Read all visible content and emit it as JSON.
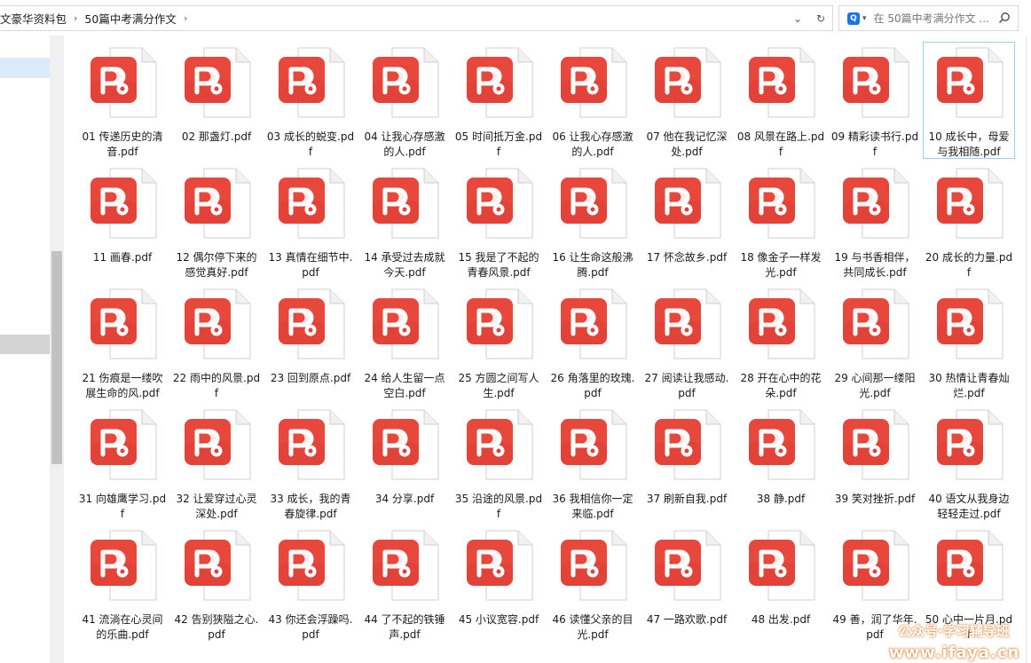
{
  "address_bar": {
    "crumbs": [
      "文豪华资料包",
      "50篇中考满分作文"
    ],
    "separator": "›",
    "dropdown_glyph": "⌄",
    "refresh_glyph": "↻"
  },
  "search": {
    "placeholder": "在 50篇中考满分作文 ...",
    "app_badge": "Q",
    "dropdown_glyph": "▾"
  },
  "colors": {
    "pdf_red": "#e8473c",
    "pdf_red_dark": "#d93a33",
    "selection_blue": "#dcebfa",
    "focus_border": "#99d1e6"
  },
  "icon_name": "pdf-file-icon",
  "files": [
    "01 传递历史的清音.pdf",
    "02 那盏灯.pdf",
    "03 成长的蜕变.pdf",
    "04 让我心存感激的人.pdf",
    "05 时间抵万金.pdf",
    "06 让我心存感激的人.pdf",
    "07 他在我记忆深处.pdf",
    "08 风景在路上.pdf",
    "09 精彩读书行.pdf",
    "10 成长中，母爱与我相随.pdf",
    "11 画春.pdf",
    "12 偶尔停下来的感觉真好.pdf",
    "13 真情在细节中.pdf",
    "14 承受过去成就今天.pdf",
    "15 我是了不起的青春风景.pdf",
    "16 让生命这般沸腾.pdf",
    "17 怀念故乡.pdf",
    "18 像金子一样发光.pdf",
    "19 与书香相伴，共同成长.pdf",
    "20 成长的力量.pdf",
    "21 伤痕是一缕吹展生命的风.pdf",
    "22 雨中的风景.pdf",
    "23 回到原点.pdf",
    "24 给人生留一点空白.pdf",
    "25 方圆之间写人生.pdf",
    "26 角落里的玫瑰.pdf",
    "27 阅读让我感动.pdf",
    "28 开在心中的花朵.pdf",
    "29 心间那一缕阳光.pdf",
    "30 热情让青春灿烂.pdf",
    "31 向雄鹰学习.pdf",
    "32 让爱穿过心灵深处.pdf",
    "33 成长，我的青春旋律.pdf",
    "34 分享.pdf",
    "35 沿途的风景.pdf",
    "36 我相信你一定来临.pdf",
    "37 刷新自我.pdf",
    "38 静.pdf",
    "39 笑对挫折.pdf",
    "40 语文从我身边轻轻走过.pdf",
    "41 流淌在心灵间的乐曲.pdf",
    "42 告别狭隘之心.pdf",
    "43 你还会浮躁吗.pdf",
    "44 了不起的铁锤声.pdf",
    "45 小议宽容.pdf",
    "46 读懂父亲的目光.pdf",
    "47 一路欢歌.pdf",
    "48 出发.pdf",
    "49 善，润了华年.pdf",
    "50 心中一片月.pdf"
  ],
  "focused_index": 9,
  "watermark": {
    "line1": "公众号·学习辅导班",
    "line2": "www.ifaya.cn"
  }
}
